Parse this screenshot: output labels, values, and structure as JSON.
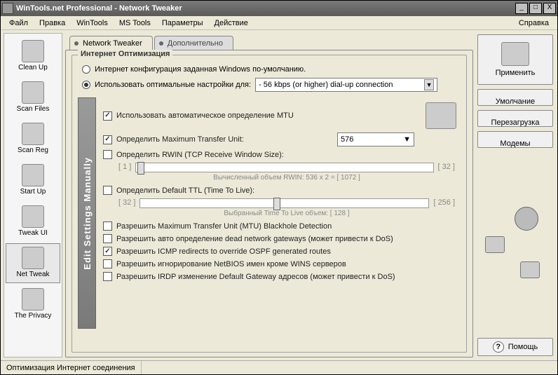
{
  "window": {
    "title": "WinTools.net Professional - Network Tweaker"
  },
  "menu": {
    "file": "Файл",
    "edit": "Правка",
    "wintools": "WinTools",
    "mstools": "MS Tools",
    "params": "Параметры",
    "action": "Действие",
    "help": "Справка"
  },
  "sidebar": {
    "items": [
      {
        "label": "Clean Up"
      },
      {
        "label": "Scan Files"
      },
      {
        "label": "Scan Reg"
      },
      {
        "label": "Start Up"
      },
      {
        "label": "Tweak UI"
      },
      {
        "label": "Net Tweak"
      },
      {
        "label": "The Privacy"
      }
    ]
  },
  "tabs": {
    "network": "Network Tweaker",
    "extra": "Дополнительно"
  },
  "group": {
    "title": "Интернет Оптимизация",
    "radio_default": "Интернет конфигурация заданная Windows по-умолчанию.",
    "radio_optimal": "Использовать оптимальные настройки для:",
    "connection": "- 56 kbps (or higher) dial-up connection"
  },
  "settings": {
    "vbar": "Edit   Settings   Manually",
    "mtu_auto": "Использовать автоматическое определение MTU",
    "mtu_define": "Определить Maximum Transfer Unit:",
    "mtu_value": "576",
    "rwin": "Определить RWIN (TCP Receive Window Size):",
    "rwin_min": "[ 1 ]",
    "rwin_max": "[ 32 ]",
    "rwin_caption": "Вычисленный объем RWIN: 536 x 2 = [ 1072 ]",
    "ttl": "Определить Default TTL (Time To Live):",
    "ttl_min": "[ 32 ]",
    "ttl_max": "[ 256 ]",
    "ttl_caption": "Выбранный Time To Live объем: [ 128 ]",
    "blackhole": "Разрешить Maximum Transfer Unit (MTU) Blackhole Detection",
    "deadgw": "Разрешить авто определение dead network gateways (может привести к DoS)",
    "icmp": "Разрешить ICMP redirects to override OSPF generated routes",
    "netbios": "Разрешить игнорирование NetBIOS имен кроме WINS серверов",
    "irdp": "Разрешить IRDP изменение Default Gateway адресов (может привести к DoS)"
  },
  "right": {
    "apply": "Применить",
    "defaults": "Умолчание",
    "restart": "Перезагрузка",
    "modems": "Модемы",
    "help": "Помощь"
  },
  "status": {
    "text": "Оптимизация Интернет соединения"
  }
}
